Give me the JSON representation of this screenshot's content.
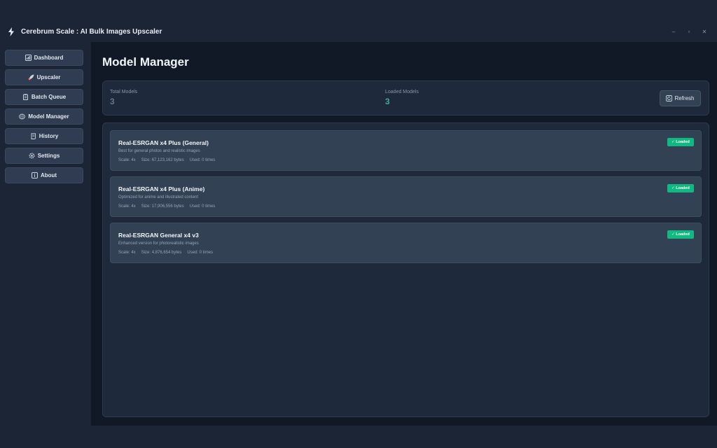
{
  "app": {
    "title": "Cerebrum Scale : AI Bulk Images Upscaler",
    "minimize": "–",
    "maximize": "▫",
    "close": "✕"
  },
  "sidebar": {
    "items": [
      {
        "label": "Dashboard",
        "icon": "dashboard-icon"
      },
      {
        "label": "Upscaler",
        "icon": "rocket-icon"
      },
      {
        "label": "Batch Queue",
        "icon": "clipboard-icon"
      },
      {
        "label": "Model Manager",
        "icon": "brain-icon"
      },
      {
        "label": "History",
        "icon": "scroll-icon"
      },
      {
        "label": "Settings",
        "icon": "gear-icon"
      },
      {
        "label": "About",
        "icon": "info-icon"
      }
    ]
  },
  "main": {
    "title": "Model Manager",
    "stats": {
      "total_label": "Total Models",
      "total_value": "3",
      "loaded_label": "Loaded Models",
      "loaded_value": "3"
    },
    "refresh_label": "Refresh"
  },
  "models": [
    {
      "name": "Real-ESRGAN x4 Plus (General)",
      "description": "Best for general photos and realistic images",
      "scale": "Scale: 4x",
      "size": "Size: 67,123,162 bytes",
      "used": "Used: 0 times",
      "status": "✓ Loaded"
    },
    {
      "name": "Real-ESRGAN x4 Plus (Anime)",
      "description": "Optimized for anime and illustrated content",
      "scale": "Scale: 4x",
      "size": "Size: 17,906,556 bytes",
      "used": "Used: 0 times",
      "status": "✓ Loaded"
    },
    {
      "name": "Real-ESRGAN General x4 v3",
      "description": "Enhanced version for photorealistic images",
      "scale": "Scale: 4x",
      "size": "Size: 4,876,654 bytes",
      "used": "Used: 0 times",
      "status": "✓ Loaded"
    }
  ],
  "colors": {
    "accent_green": "#10b981",
    "loaded_teal": "#4aa39b"
  }
}
